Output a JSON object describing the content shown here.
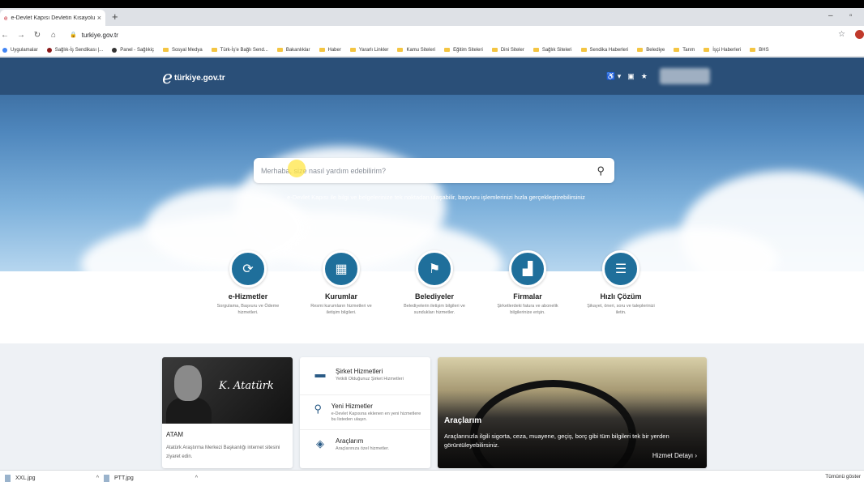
{
  "browser": {
    "tab_title": "e-Devlet Kapısı Devletin Kısayolu",
    "url": "turkiye.gov.tr",
    "bookmarks": [
      "Uygulamalar",
      "Sağlık-İş Sendikası |...",
      "Panel - Sağlıkiç",
      "Sosyal Medya",
      "Türk-İş'e Bağlı Send...",
      "Bakanlıklar",
      "Haber",
      "Yararlı Linkler",
      "Kamu Siteleri",
      "Eğitim Siteleri",
      "Dini Siteler",
      "Sağlık Siteleri",
      "Sendika Haberleri",
      "Belediye",
      "Tarım",
      "İşçi Haberleri",
      "BHS"
    ]
  },
  "header": {
    "logo_text": "türkiye.gov.tr"
  },
  "search": {
    "placeholder": "Merhaba, size nasıl yardım edebilirim?",
    "tagline": "e-Devlet Kapısı ile bilgi ve belgelerinize tek noktadan ulaşabilir, başvuru işlemlerinizi hızla gerçekleştirebilirsiniz"
  },
  "categories": [
    {
      "name": "e-Hizmetler",
      "desc": "Sorgulama, Başvuru ve Ödeme hizmetleri.",
      "icon": "refresh-icon"
    },
    {
      "name": "Kurumlar",
      "desc": "Resmi kurumların hizmetleri ve iletişim bilgileri.",
      "icon": "building-icon"
    },
    {
      "name": "Belediyeler",
      "desc": "Belediyelerin iletişim bilgileri ve sundukları hizmetler.",
      "icon": "signpost-icon"
    },
    {
      "name": "Firmalar",
      "desc": "Şirketlerdeki fatura ve abonelik bilgilerinize erişin.",
      "icon": "factory-icon"
    },
    {
      "name": "Hızlı Çözüm",
      "desc": "Şikayet, öneri, soru ve taleplerinizi iletin.",
      "icon": "chat-icon"
    }
  ],
  "cards": {
    "atam": {
      "title": "ATAM",
      "desc": "Atatürk Araştırma Merkezi Başkanlığı internet sitesini ziyaret edin.",
      "signature": "K. Atatürk"
    },
    "services": [
      {
        "title": "Şirket Hizmetleri",
        "desc": "Yetkili Olduğunuz Şirket Hizmetleri",
        "icon": "briefcase-icon"
      },
      {
        "title": "Yeni Hizmetler",
        "desc": "e-Devlet Kapısına eklenen en yeni hizmetlere bu listeden ulaşın.",
        "icon": "pin-icon"
      },
      {
        "title": "Araçlarım",
        "desc": "Araçlarınıza özel hizmetler.",
        "icon": "car-icon"
      }
    ],
    "feature": {
      "title": "Araçlarım",
      "desc": "Araçlarınızla ilgili sigorta, ceza, muayene, geçiş, borç gibi tüm bilgileri tek bir yerden görüntüleyebilirsiniz.",
      "button": "Hizmet Detayı"
    }
  },
  "downloads": {
    "items": [
      "XXL.jpg",
      "PTT.jpg"
    ],
    "show_all": "Tümünü göster"
  }
}
